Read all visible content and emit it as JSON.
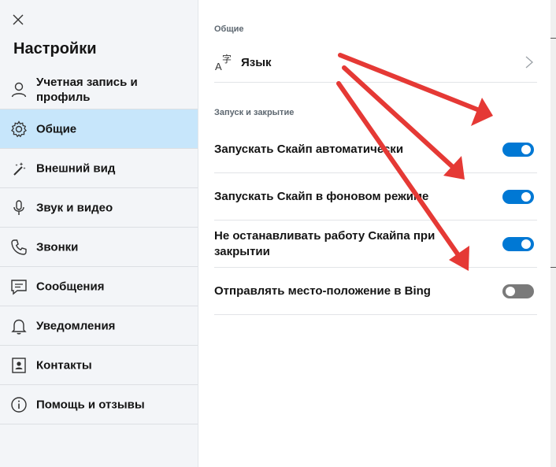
{
  "sidebar": {
    "title": "Настройки",
    "items": [
      {
        "label": "Учетная запись и профиль",
        "icon": "person-icon"
      },
      {
        "label": "Общие",
        "icon": "gear-icon"
      },
      {
        "label": "Внешний вид",
        "icon": "magic-wand-icon"
      },
      {
        "label": "Звук и видео",
        "icon": "microphone-icon"
      },
      {
        "label": "Звонки",
        "icon": "phone-icon"
      },
      {
        "label": "Сообщения",
        "icon": "chat-icon"
      },
      {
        "label": "Уведомления",
        "icon": "bell-icon"
      },
      {
        "label": "Контакты",
        "icon": "contact-book-icon"
      },
      {
        "label": "Помощь и отзывы",
        "icon": "info-icon"
      }
    ],
    "active_item": "Общие"
  },
  "main": {
    "section_general": "Общие",
    "language_label": "Язык",
    "section_startup": "Запуск и закрытие",
    "toggles": [
      {
        "label": "Запускать Скайп автоматически",
        "on": true
      },
      {
        "label": "Запускать Скайп в фоновом режиме",
        "on": true
      },
      {
        "label": "Не останавливать работу Скайпа при закрытии",
        "on": true
      },
      {
        "label": "Отправлять место-положение в Bing",
        "on": false
      }
    ]
  },
  "colors": {
    "accent": "#0078d4",
    "active_bg": "#c7e6fb",
    "toggle_off": "#7a7a7a",
    "annotation_arrow": "#e53935"
  }
}
